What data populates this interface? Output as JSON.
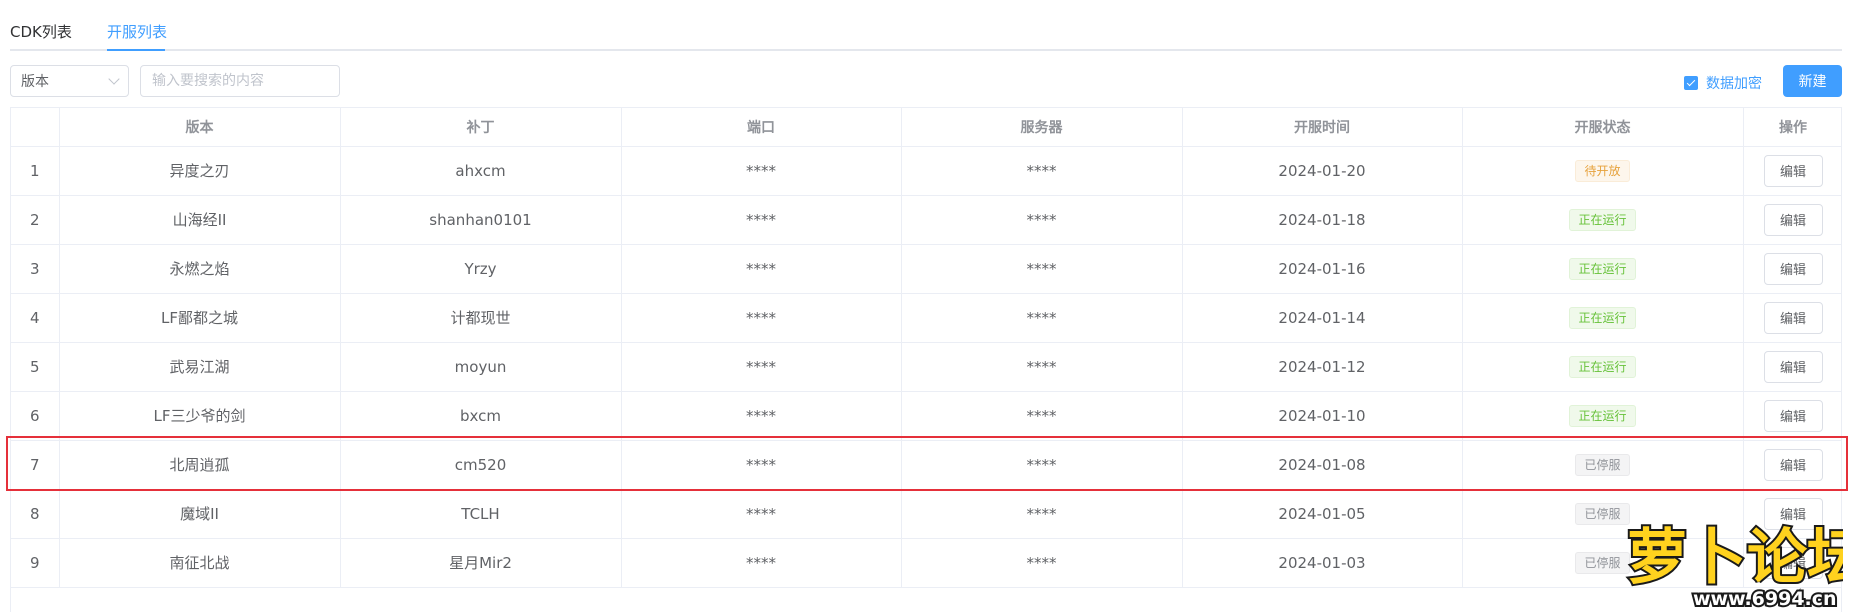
{
  "tabs": [
    {
      "label": "CDK列表",
      "active": false
    },
    {
      "label": "开服列表",
      "active": true
    }
  ],
  "toolbar": {
    "version_select": "版本",
    "search_placeholder": "输入要搜索的内容",
    "encrypt_label": "数据加密",
    "encrypt_checked": true,
    "new_label": "新建"
  },
  "table": {
    "headers": [
      "版本",
      "补丁",
      "端口",
      "服务器",
      "开服时间",
      "开服状态",
      "操作"
    ],
    "rows": [
      {
        "index": "1",
        "version": "异度之刃",
        "patch": "ahxcm",
        "port": "****",
        "server": "****",
        "date": "2024-01-20",
        "status": "待开放",
        "action": "编辑"
      },
      {
        "index": "2",
        "version": "山海经II",
        "patch": "shanhan0101",
        "port": "****",
        "server": "****",
        "date": "2024-01-18",
        "status": "正在运行",
        "action": "编辑"
      },
      {
        "index": "3",
        "version": "永燃之焰",
        "patch": "Yrzy",
        "port": "****",
        "server": "****",
        "date": "2024-01-16",
        "status": "正在运行",
        "action": "编辑"
      },
      {
        "index": "4",
        "version": "LF鄙都之城",
        "patch": "计都现世",
        "port": "****",
        "server": "****",
        "date": "2024-01-14",
        "status": "正在运行",
        "action": "编辑"
      },
      {
        "index": "5",
        "version": "武易江湖",
        "patch": "moyun",
        "port": "****",
        "server": "****",
        "date": "2024-01-12",
        "status": "正在运行",
        "action": "编辑"
      },
      {
        "index": "6",
        "version": "LF三少爷的剑",
        "patch": "bxcm",
        "port": "****",
        "server": "****",
        "date": "2024-01-10",
        "status": "正在运行",
        "action": "编辑"
      },
      {
        "index": "7",
        "version": "北周逍孤",
        "patch": "cm520",
        "port": "****",
        "server": "****",
        "date": "2024-01-08",
        "status": "已停服",
        "action": "编辑"
      },
      {
        "index": "8",
        "version": "魔域II",
        "patch": "TCLH",
        "port": "****",
        "server": "****",
        "date": "2024-01-05",
        "status": "已停服",
        "action": "编辑"
      },
      {
        "index": "9",
        "version": "南征北战",
        "patch": "星月Mir2",
        "port": "****",
        "server": "****",
        "date": "2024-01-03",
        "status": "已停服",
        "action": "编辑"
      }
    ]
  },
  "colors": {
    "primary": "#409eff",
    "pending": "#e6a23c",
    "running": "#67c23a",
    "stopped": "#909399",
    "highlight": "#e5303a"
  },
  "watermark": {
    "text": "萝卜论坛",
    "url": "www.6994.cn"
  }
}
